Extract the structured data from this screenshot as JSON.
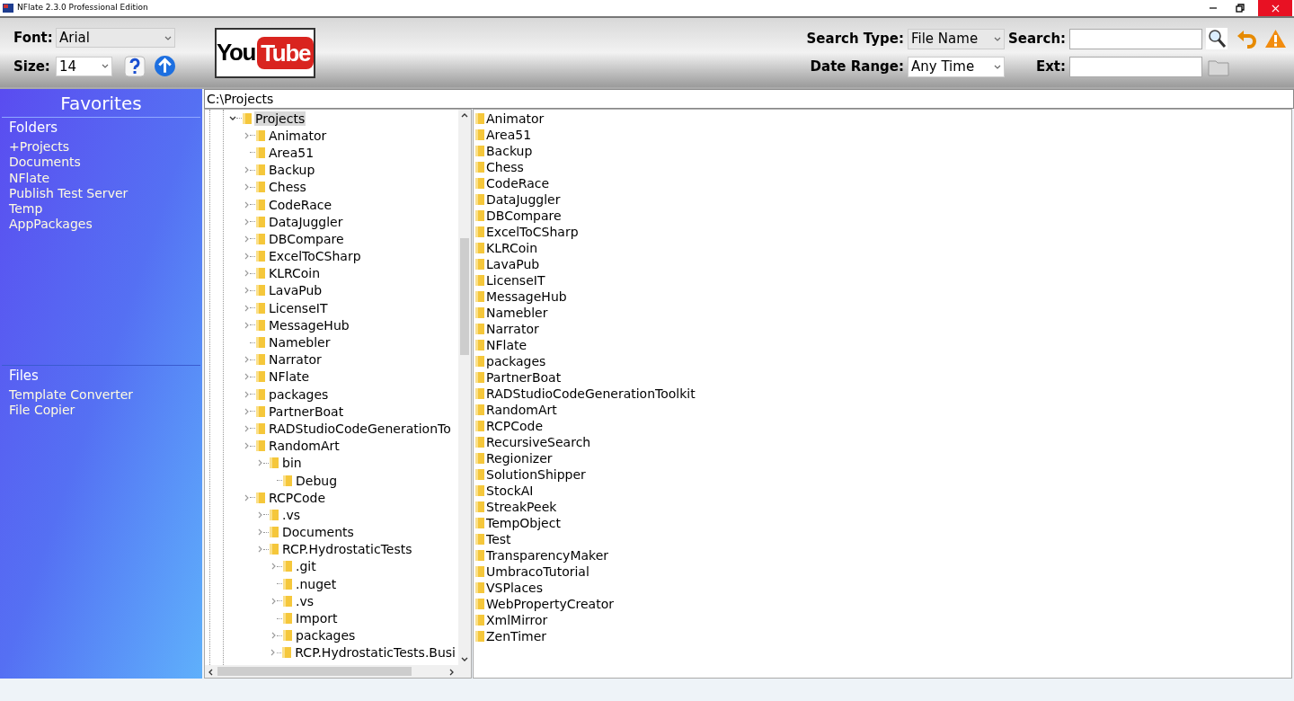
{
  "window": {
    "title": "NFlate 2.3.0 Professional Edition"
  },
  "toolbar": {
    "font": {
      "label": "Font:",
      "value": "Arial"
    },
    "size": {
      "label": "Size:",
      "value": "14"
    },
    "logo": {
      "left": "You",
      "right": "Tube"
    },
    "search_type": {
      "label": "Search Type:",
      "value": "File Name"
    },
    "search": {
      "label": "Search:"
    },
    "date_range": {
      "label": "Date Range:",
      "value": "Any Time"
    },
    "ext": {
      "label": "Ext:"
    }
  },
  "sidebar": {
    "title": "Favorites",
    "sections": [
      {
        "title": "Folders",
        "items": [
          "+Projects",
          "Documents",
          "NFlate",
          "Publish Test Server",
          "Temp",
          "AppPackages"
        ]
      },
      {
        "title": "Files",
        "items": [
          "Template Converter",
          "File Copier"
        ]
      }
    ]
  },
  "path": "C:\\Projects",
  "tree": [
    {
      "label": "Projects",
      "expandable": true,
      "expanded": true,
      "selected": true,
      "children": [
        {
          "label": "Animator",
          "expandable": true,
          "expanded": false,
          "selected": false
        },
        {
          "label": "Area51",
          "expandable": false,
          "selected": false
        },
        {
          "label": "Backup",
          "expandable": true,
          "expanded": false,
          "selected": false
        },
        {
          "label": "Chess",
          "expandable": true,
          "expanded": false,
          "selected": false
        },
        {
          "label": "CodeRace",
          "expandable": true,
          "expanded": false,
          "selected": false
        },
        {
          "label": "DataJuggler",
          "expandable": true,
          "expanded": false,
          "selected": false
        },
        {
          "label": "DBCompare",
          "expandable": true,
          "expanded": false,
          "selected": false
        },
        {
          "label": "ExcelToCSharp",
          "expandable": true,
          "expanded": false,
          "selected": false
        },
        {
          "label": "KLRCoin",
          "expandable": true,
          "expanded": false,
          "selected": false
        },
        {
          "label": "LavaPub",
          "expandable": true,
          "expanded": false,
          "selected": false
        },
        {
          "label": "LicenseIT",
          "expandable": true,
          "expanded": false,
          "selected": false
        },
        {
          "label": "MessageHub",
          "expandable": true,
          "expanded": false,
          "selected": false
        },
        {
          "label": "Namebler",
          "expandable": false,
          "selected": false
        },
        {
          "label": "Narrator",
          "expandable": true,
          "expanded": false,
          "selected": false
        },
        {
          "label": "NFlate",
          "expandable": true,
          "expanded": false,
          "selected": false
        },
        {
          "label": "packages",
          "expandable": true,
          "expanded": false,
          "selected": false
        },
        {
          "label": "PartnerBoat",
          "expandable": true,
          "expanded": false,
          "selected": false
        },
        {
          "label": "RADStudioCodeGenerationTo",
          "expandable": true,
          "expanded": false,
          "selected": false
        },
        {
          "label": "RandomArt",
          "expandable": true,
          "expanded": false,
          "selected": false,
          "children": [
            {
              "label": "bin",
              "expandable": true,
              "expanded": false,
              "selected": false,
              "children": [
                {
                  "label": "Debug",
                  "expandable": false,
                  "selected": false
                }
              ]
            }
          ]
        },
        {
          "label": "RCPCode",
          "expandable": true,
          "expanded": false,
          "selected": false,
          "children": [
            {
              "label": ".vs",
              "expandable": true,
              "expanded": false,
              "selected": false
            },
            {
              "label": "Documents",
              "expandable": true,
              "expanded": false,
              "selected": false
            },
            {
              "label": "RCP.HydrostaticTests",
              "expandable": true,
              "expanded": false,
              "selected": false,
              "children": [
                {
                  "label": ".git",
                  "expandable": true,
                  "expanded": false,
                  "selected": false
                },
                {
                  "label": ".nuget",
                  "expandable": false,
                  "selected": false
                },
                {
                  "label": ".vs",
                  "expandable": true,
                  "expanded": false,
                  "selected": false
                },
                {
                  "label": "Import",
                  "expandable": false,
                  "selected": false
                },
                {
                  "label": "packages",
                  "expandable": true,
                  "expanded": false,
                  "selected": false
                },
                {
                  "label": "RCP.HydrostaticTests.Busi",
                  "expandable": true,
                  "expanded": false,
                  "selected": false
                }
              ]
            }
          ]
        }
      ]
    }
  ],
  "files": [
    "Animator",
    "Area51",
    "Backup",
    "Chess",
    "CodeRace",
    "DataJuggler",
    "DBCompare",
    "ExcelToCSharp",
    "KLRCoin",
    "LavaPub",
    "LicenseIT",
    "MessageHub",
    "Namebler",
    "Narrator",
    "NFlate",
    "packages",
    "PartnerBoat",
    "RADStudioCodeGenerationToolkit",
    "RandomArt",
    "RCPCode",
    "RecursiveSearch",
    "Regionizer",
    "SolutionShipper",
    "StockAI",
    "StreakPeek",
    "TempObject",
    "Test",
    "TransparencyMaker",
    "UmbracoTutorial",
    "VSPlaces",
    "WebPropertyCreator",
    "XmlMirror",
    "ZenTimer"
  ]
}
